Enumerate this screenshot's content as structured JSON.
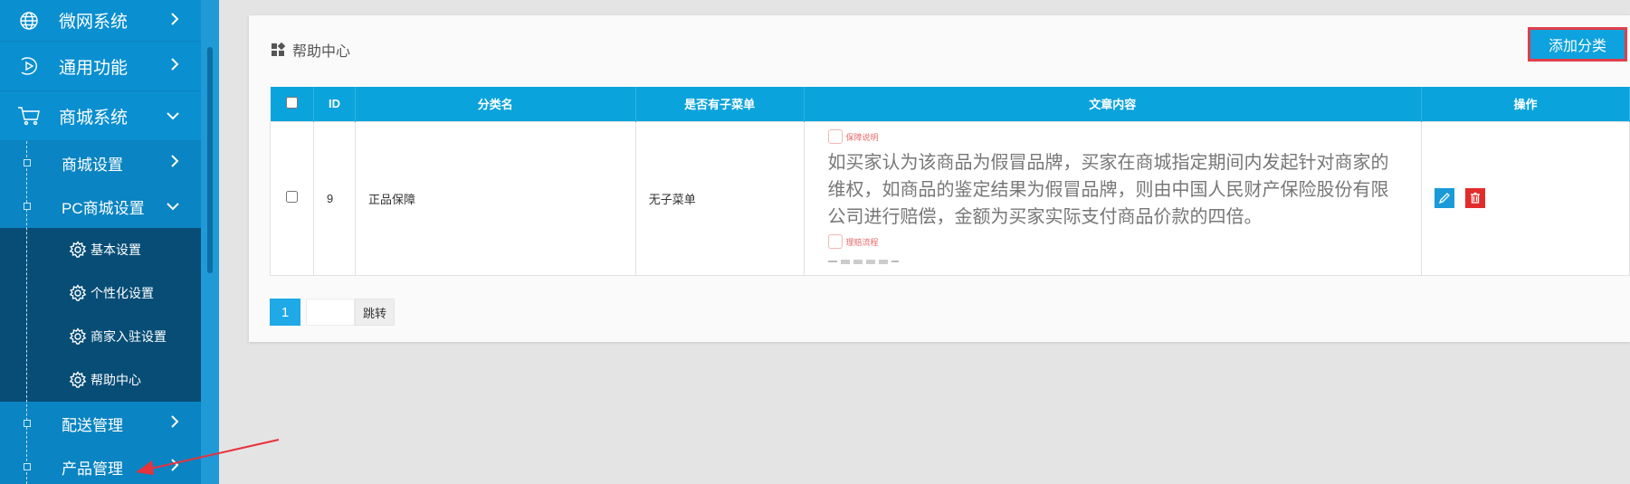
{
  "sidebar": {
    "items": [
      {
        "label": "微网系统",
        "icon": "globe-icon"
      },
      {
        "label": "通用功能",
        "icon": "play-circle-icon"
      },
      {
        "label": "商城系统",
        "icon": "cart-icon"
      }
    ],
    "sub_items": [
      {
        "label": "商城设置"
      },
      {
        "label": "PC商城设置"
      }
    ],
    "third_items": [
      {
        "label": "基本设置"
      },
      {
        "label": "个性化设置"
      },
      {
        "label": "商家入驻设置"
      },
      {
        "label": "帮助中心"
      }
    ],
    "sub_items_after": [
      {
        "label": "配送管理"
      },
      {
        "label": "产品管理"
      }
    ]
  },
  "panel": {
    "title": "帮助中心",
    "add_button": "添加分类"
  },
  "table": {
    "headers": [
      "ID",
      "分类名",
      "是否有子菜单",
      "文章内容",
      "操作"
    ],
    "rows": [
      {
        "id": "9",
        "name": "正品保障",
        "has_sub": "无子菜单",
        "tag1": "保障说明",
        "content": "如买家认为该商品为假冒品牌，买家在商城指定期间内发起针对商家的维权，如商品的鉴定结果为假冒品牌，则由中国人民财产保险股份有限公司进行赔偿，金额为买家实际支付商品价款的四倍。",
        "tag2": "理赔流程"
      }
    ]
  },
  "pager": {
    "current": "1",
    "jump_label": "跳转"
  },
  "colors": {
    "sidebar": "#0a8fd1",
    "submenu": "#074d76",
    "accent": "#0ea2de",
    "delete": "#e22c2c",
    "highlight_border": "#e03e4b"
  }
}
